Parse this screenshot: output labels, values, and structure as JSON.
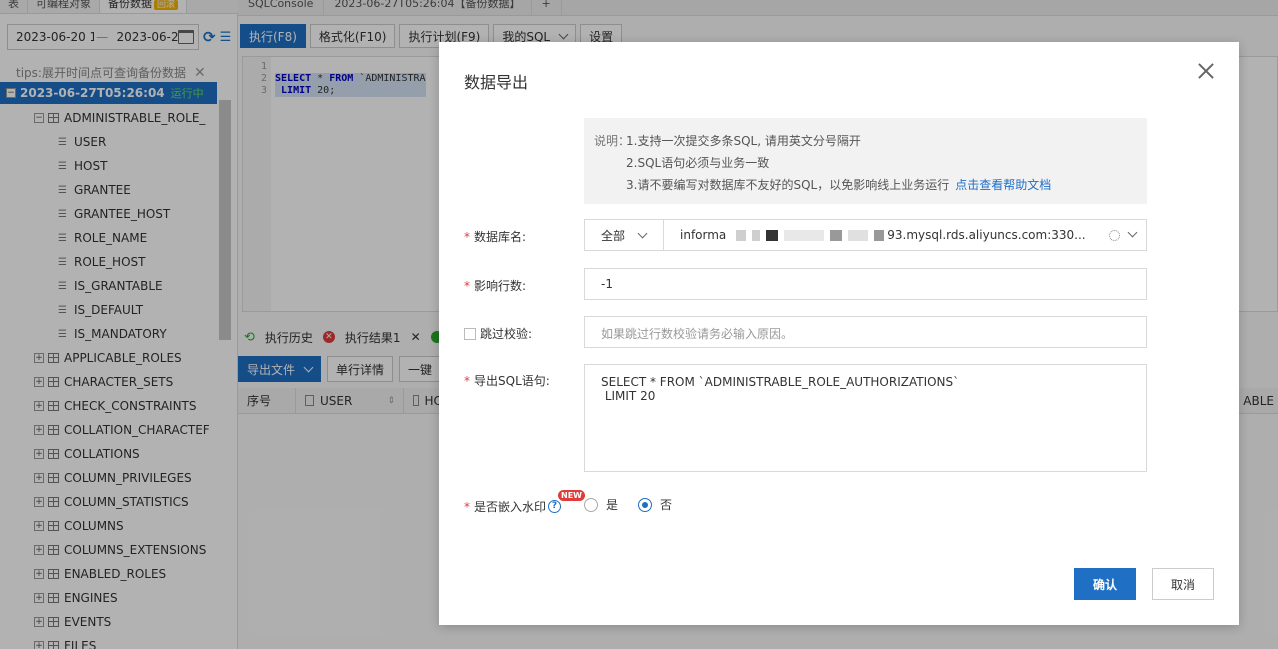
{
  "left_panel": {
    "top_tabs": [
      {
        "label": "表"
      },
      {
        "label": "可编程对象"
      },
      {
        "label": "备份数据",
        "badge": "回滚"
      }
    ],
    "date_range": {
      "start": "2023-06-20 1",
      "end": "2023-06-2"
    },
    "tips": "tips:展开时间点可查询备份数据",
    "root_node": {
      "label": "2023-06-27T05:26:04",
      "status": "运行中"
    },
    "tables": [
      {
        "name": "ADMINISTRABLE_ROLE_",
        "expanded": true,
        "columns": [
          "USER",
          "HOST",
          "GRANTEE",
          "GRANTEE_HOST",
          "ROLE_NAME",
          "ROLE_HOST",
          "IS_GRANTABLE",
          "IS_DEFAULT",
          "IS_MANDATORY"
        ]
      },
      {
        "name": "APPLICABLE_ROLES"
      },
      {
        "name": "CHARACTER_SETS"
      },
      {
        "name": "CHECK_CONSTRAINTS"
      },
      {
        "name": "COLLATION_CHARACTEF"
      },
      {
        "name": "COLLATIONS"
      },
      {
        "name": "COLUMN_PRIVILEGES"
      },
      {
        "name": "COLUMN_STATISTICS"
      },
      {
        "name": "COLUMNS"
      },
      {
        "name": "COLUMNS_EXTENSIONS"
      },
      {
        "name": "ENABLED_ROLES"
      },
      {
        "name": "ENGINES"
      },
      {
        "name": "EVENTS"
      },
      {
        "name": "FILES"
      }
    ]
  },
  "right_panel": {
    "tabs": [
      "SQLConsole",
      "2023-06-27T05:26:04【备份数据】",
      "+"
    ],
    "toolbar": {
      "run": "执行(F8)",
      "format": "格式化(F10)",
      "plan": "执行计划(F9)",
      "my_sql": "我的SQL",
      "settings": "设置"
    },
    "editor": {
      "line_numbers": [
        "1",
        "2",
        "3"
      ],
      "line2_kw1": "SELECT",
      "line2_rest": " * ",
      "line2_kw2": "FROM",
      "line2_tail": " `ADMINISTRA",
      "line3_kw": "LIMIT",
      "line3_tail": " 20;"
    },
    "result_tabs": {
      "history": "执行历史",
      "result1": "执行结果1"
    },
    "result_toolbar": {
      "export": "导出文件",
      "row_detail": "单行详情",
      "more": "一键"
    },
    "table_headers": [
      "序号",
      "USER",
      "HO",
      "ABLE"
    ]
  },
  "modal": {
    "title": "数据导出",
    "notice": {
      "label": "说明：",
      "line1": "1.支持一次提交多条SQL, 请用英文分号隔开",
      "line2": "2.SQL语句必须与业务一致",
      "line3": "3.请不要编写对数据库不友好的SQL，以免影响线上业务运行",
      "help_link": "点击查看帮助文档"
    },
    "db": {
      "label": "数据库名:",
      "scope": "全部",
      "value_prefix": "informa",
      "value_suffix": "93.mysql.rds.aliyuncs.com:330..."
    },
    "rows": {
      "label": "影响行数:",
      "value": "-1"
    },
    "skip": {
      "label": "跳过校验:",
      "placeholder": "如果跳过行数校验请务必输入原因。"
    },
    "sql": {
      "label": "导出SQL语句:",
      "value": "SELECT * FROM `ADMINISTRABLE_ROLE_AUTHORIZATIONS`\n LIMIT 20"
    },
    "watermark": {
      "label": "是否嵌入水印",
      "new_badge": "NEW",
      "yes": "是",
      "no": "否",
      "selected": "否"
    },
    "buttons": {
      "confirm": "确认",
      "cancel": "取消"
    }
  }
}
